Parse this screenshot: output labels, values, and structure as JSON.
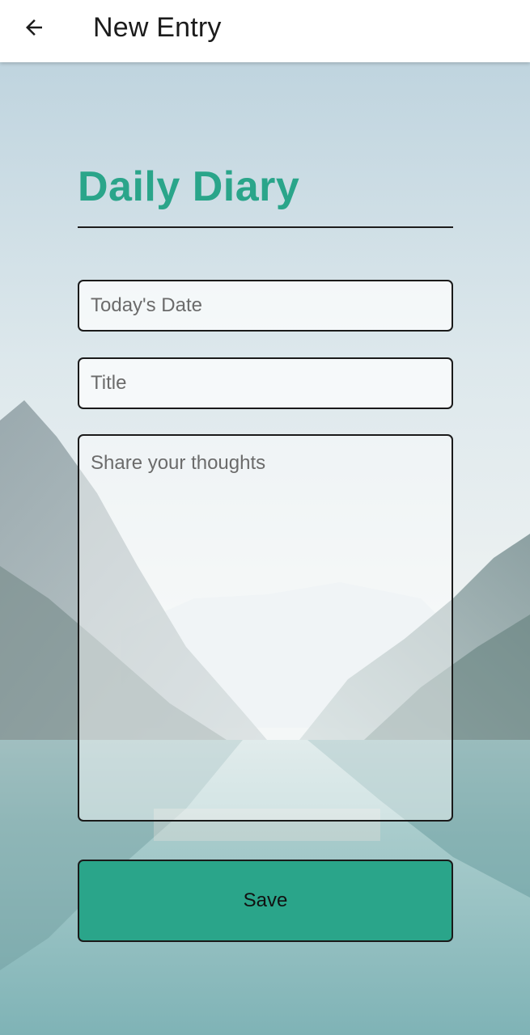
{
  "appbar": {
    "title": "New Entry",
    "back_icon": "arrow-left-icon"
  },
  "form": {
    "heading": "Daily Diary",
    "date_placeholder": "Today's Date",
    "title_placeholder": "Title",
    "body_placeholder": "Share your thoughts",
    "save_label": "Save"
  },
  "colors": {
    "accent": "#2aa58a",
    "appbar_bg": "#ffffff",
    "text_dark": "#1b1b1b"
  },
  "background": {
    "icon": "mountain-lake-photo"
  }
}
